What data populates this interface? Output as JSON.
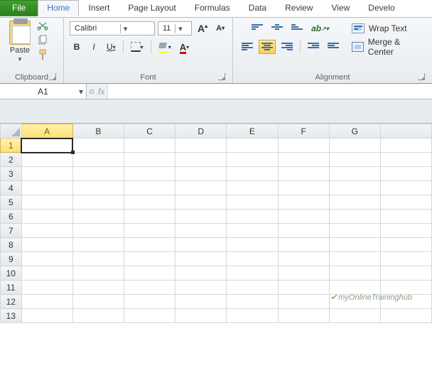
{
  "tabs": {
    "file": "File",
    "items": [
      "Home",
      "Insert",
      "Page Layout",
      "Formulas",
      "Data",
      "Review",
      "View",
      "Develo"
    ],
    "active_index": 0
  },
  "ribbon": {
    "clipboard": {
      "label": "Clipboard",
      "paste": "Paste"
    },
    "font": {
      "label": "Font",
      "name": "Calibri",
      "size": "11",
      "increase": "A",
      "decrease": "A",
      "bold": "B",
      "italic": "I",
      "underline": "U"
    },
    "alignment": {
      "label": "Alignment",
      "wrap": "Wrap Text",
      "merge": "Merge & Center"
    }
  },
  "namebox": "A1",
  "fx_label": "fx",
  "columns": [
    "A",
    "B",
    "C",
    "D",
    "E",
    "F",
    "G"
  ],
  "rows": [
    "1",
    "2",
    "3",
    "4",
    "5",
    "6",
    "7",
    "8",
    "9",
    "10",
    "11",
    "12",
    "13"
  ],
  "selection": {
    "col": 0,
    "row": 0
  },
  "watermark": "myOnlineTraininghub"
}
